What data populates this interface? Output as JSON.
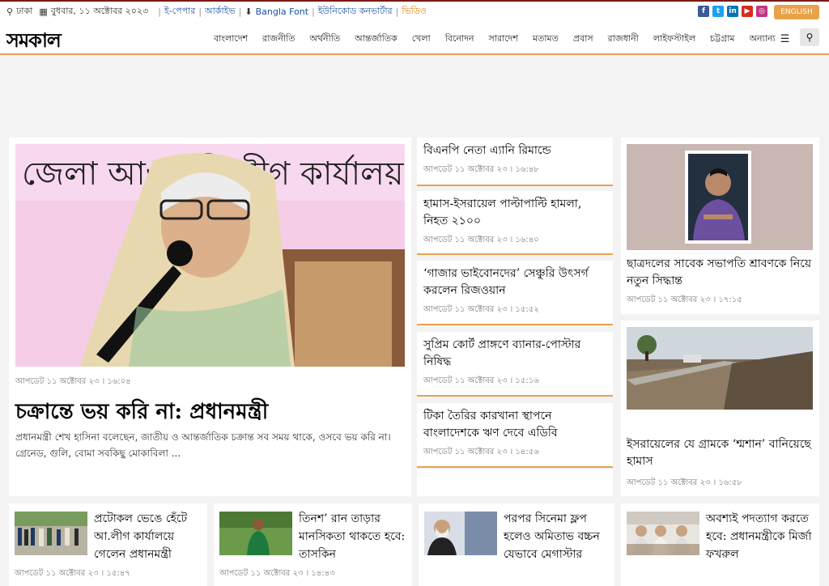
{
  "topbar": {
    "location": "ঢাকা",
    "date": "বুধবার, ১১ অক্টোবর ২০২৩",
    "links": [
      "ই-পেপার",
      "আর্কাইভ",
      "Bangla Font",
      "ইউনিকোড কনভার্টার",
      "ভিডিও"
    ],
    "social": [
      "f",
      "t",
      "in",
      "▶",
      "◎"
    ],
    "english_label": "ENGLISH"
  },
  "nav": {
    "logo": "সমকাল",
    "menu": [
      "বাংলাদেশ",
      "রাজনীতি",
      "অর্থনীতি",
      "আন্তর্জাতিক",
      "খেলা",
      "বিনোদন",
      "সারাদেশ",
      "মতামত",
      "প্রবাস",
      "রাজধানী",
      "লাইফস্টাইল",
      "চট্টগ্রাম",
      "অন্যান্য"
    ],
    "more_icon": "hamburger-icon",
    "search_icon": "search-icon"
  },
  "lead": {
    "banner_text": "জেলা আওয়ামী লীগ কার্যালয়",
    "timestamp": "আপডেট ১১ অক্টোবর ২৩ । ১৬:০৪",
    "title": "চক্রান্তে ভয় করি না: প্রধানমন্ত্রী",
    "summary": "প্রধানমন্ত্রী শেখ হাসিনা বলেছেন, জাতীয় ও আন্তর্জাতিক চক্রান্ত সব সময় থাকে, ওসবে ভয় করি না। গ্রেনেড, গুলি, বোমা সবকিছু মোকাবিলা ..."
  },
  "middle": [
    {
      "title": "বিএনপি নেতা এ্যানি রিমান্ডে",
      "timestamp": "আপডেট ১১ অক্টোবর ২৩ । ১৬:৪৮"
    },
    {
      "title": "হামাস-ইসরায়েল পাল্টাপাল্টি হামলা, নিহত ২১০০",
      "timestamp": "আপডেট ১১ অক্টোবর ২৩ । ১৬:৪০"
    },
    {
      "title": "‘গাজার ভাইবোনদের’ সেঞ্চুরি উৎসর্গ করলেন রিজওয়ান",
      "timestamp": "আপডেট ১১ অক্টোবর ২৩ । ১৫:৫২"
    },
    {
      "title": "সুপ্রিম কোর্ট প্রাঙ্গণে ব্যানার-পোস্টার নিষিদ্ধ",
      "timestamp": "আপডেট ১১ অক্টোবর ২৩ । ১৫:১৬"
    },
    {
      "title": "টিকা তৈরির কারখানা স্থাপনে বাংলাদেশকে ঋণ দেবে এডিবি",
      "timestamp": "আপডেট ১১ অক্টোবর ২৩ । ১৪:৫৬"
    }
  ],
  "right": [
    {
      "title": "ছাত্রদলের সাবেক সভাপতি শ্রাবণকে নিয়ে নতুন সিদ্ধান্ত",
      "timestamp": "আপডেট ১১ অক্টোবর ২৩ । ১৭:১৫"
    },
    {
      "title": "ইসরায়েলের যে গ্রামকে ‘শ্মশান’ বানিয়েছে হামাস",
      "timestamp": "আপডেট ১১ অক্টোবর ২৩ । ১৬:৫৮"
    }
  ],
  "bottom": [
    {
      "title": "প্রটোকল ভেঙে হেঁটে আ.লীগ কার্যালয়ে গেলেন প্রধানমন্ত্রী",
      "timestamp": "আপডেট ১১ অক্টোবর ২৩ । ১৫:৪৭"
    },
    {
      "title": "তিনশ’ রান তাড়ার মানসিকতা থাকতে হবে: তাসকিন",
      "timestamp": "আপডেট ১১ অক্টোবর ২৩ । ১৪:৪৩"
    },
    {
      "title": "পরপর সিনেমা ফ্লপ হলেও অমিতাভ বচ্চন যেভাবে মেগাস্টার",
      "timestamp": ""
    },
    {
      "title": "অবশ্যই পদত্যাগ করতে হবে: প্রধানমন্ত্রীকে মির্জা ফখরুল",
      "timestamp": ""
    }
  ],
  "colors": {
    "accent": "#e8a24a",
    "topborder": "#7a1a14",
    "link": "#1a4fa0"
  }
}
